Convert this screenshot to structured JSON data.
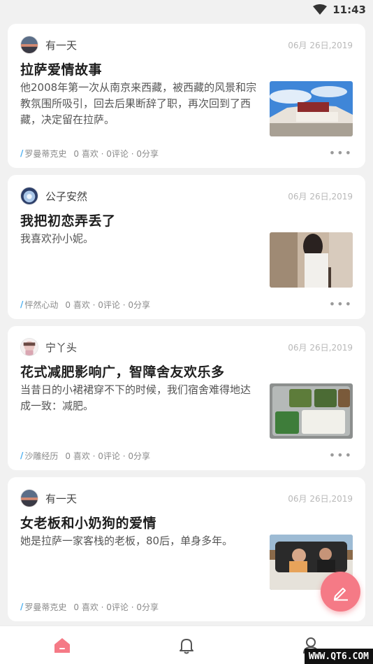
{
  "status_bar": {
    "time": "11:43"
  },
  "posts": [
    {
      "author": "有一天",
      "date": "06月 26日,2019",
      "title": "拉萨爱情故事",
      "summary": "他2008年第一次从南京来西藏，被西藏的风景和宗教氛围所吸引，回去后果断辞了职，再次回到了西藏，决定留在拉萨。",
      "tag": "罗曼蒂克史",
      "stats": "0 喜欢 · 0评论 · 0分享",
      "thumbnail": "potala-palace-photo"
    },
    {
      "author": "公子安然",
      "date": "06月 26日,2019",
      "title": "我把初恋弄丢了",
      "summary": "我喜欢孙小妮。",
      "tag": "怦然心动",
      "stats": "0 喜欢 · 0评论 · 0分享",
      "thumbnail": "girl-walking-photo"
    },
    {
      "author": "宁丫头",
      "date": "06月 26日,2019",
      "title": "花式减肥影响广，智障舍友欢乐多",
      "summary": "当昔日的小裙裙穿不下的时候，我们宿舍难得地达成一致：减肥。",
      "tag": "沙雕经历",
      "stats": "0 喜欢 · 0评论 · 0分享",
      "thumbnail": "canteen-tray-photo"
    },
    {
      "author": "有一天",
      "date": "06月 26日,2019",
      "title": "女老板和小奶狗的爱情",
      "summary": "她是拉萨一家客栈的老板，80后，单身多年。",
      "tag": "罗曼蒂克史",
      "stats": "0 喜欢 · 0评论 · 0分享",
      "thumbnail": "couple-in-car-photo"
    }
  ],
  "more_label": "•••",
  "bottom_nav": [
    {
      "icon": "home-icon",
      "active": true
    },
    {
      "icon": "bell-icon",
      "active": false
    },
    {
      "icon": "profile-icon",
      "active": false
    }
  ],
  "fab_icon": "edit-pen-icon",
  "watermark": "WWW.QT6.COM",
  "colors": {
    "accent": "#f57a86",
    "tag": "#49aef0",
    "background": "#f1f1f1"
  }
}
